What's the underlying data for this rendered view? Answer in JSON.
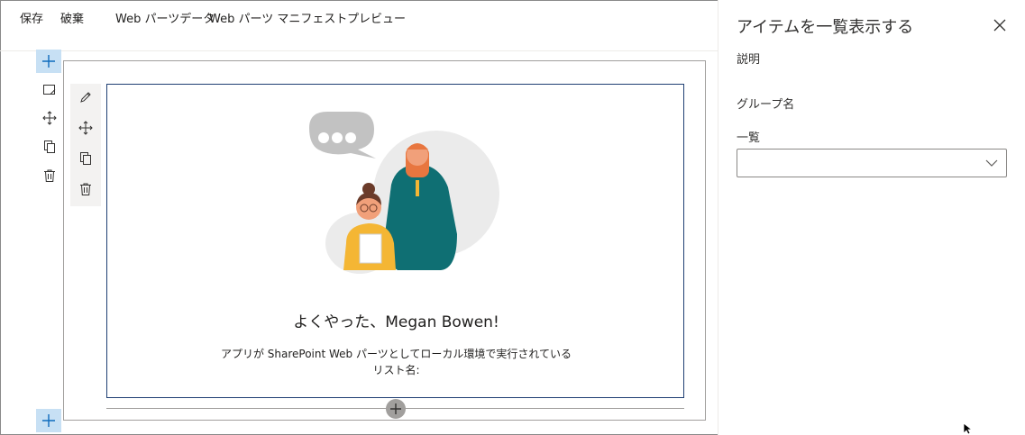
{
  "toolbar": {
    "save": "保存",
    "discard": "破棄",
    "webpart_data": "Web パーツデータ",
    "webpart_manifest": "Web パーツ マニフェスト",
    "preview": "プレビュー"
  },
  "webpart": {
    "greeting": "よくやった、Megan Bowen!",
    "description": "アプリが SharePoint Web パーツとしてローカル環境で実行されている",
    "list_label": "リスト名:"
  },
  "property_pane": {
    "title": "アイテムを一覧表示する",
    "description_label": "説明",
    "group_label": "グループ名",
    "list_label": "一覧",
    "list_value": ""
  },
  "colors": {
    "accent": "#c7e0f4",
    "webpart_border": "#1f3f73",
    "teal": "#0f6f73",
    "yellow": "#f4b634"
  },
  "icons": {
    "section_add": "plus-icon",
    "section_edit": "edit-icon",
    "section_move": "move-icon",
    "section_duplicate": "duplicate-icon",
    "section_delete": "delete-icon",
    "close": "close-icon",
    "dropdown": "chevron-down-icon"
  }
}
